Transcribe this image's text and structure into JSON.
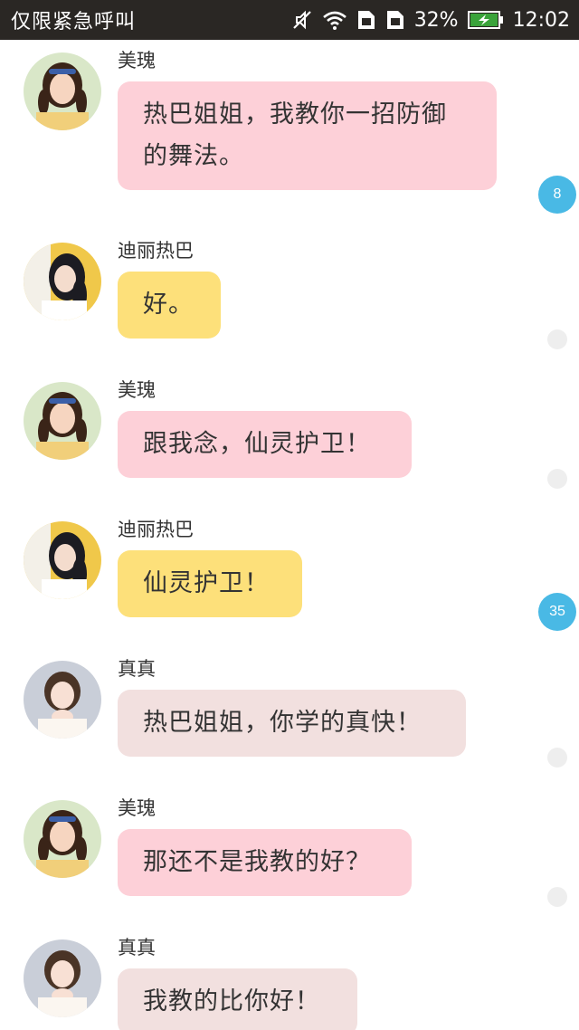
{
  "status_bar": {
    "carrier_text": "仅限紧急呼叫",
    "battery_percent": "32%",
    "time": "12:02",
    "icons": [
      "mute-icon",
      "wifi-icon",
      "sim-card-icon",
      "sim-card-icon",
      "battery-charging-icon"
    ]
  },
  "messages": [
    {
      "sender": "美瑰",
      "text": "热巴姐姐，我教你一招防御的舞法。",
      "badge": "8"
    },
    {
      "sender": "迪丽热巴",
      "text": "好。"
    },
    {
      "sender": "美瑰",
      "text": "跟我念，仙灵护卫！"
    },
    {
      "sender": "迪丽热巴",
      "text": "仙灵护卫！",
      "badge": "35"
    },
    {
      "sender": "真真",
      "text": "热巴姐姐，你学的真快！"
    },
    {
      "sender": "美瑰",
      "text": "那还不是我教的好？"
    },
    {
      "sender": "真真",
      "text": "我教的比你好！"
    }
  ],
  "colors": {
    "status_bar_bg": "#2a2724",
    "bubble_meigui": "#fdd0d8",
    "bubble_dilireba": "#fde07a",
    "bubble_zhenzhen": "#f2e0df",
    "badge": "#49b9e5"
  }
}
